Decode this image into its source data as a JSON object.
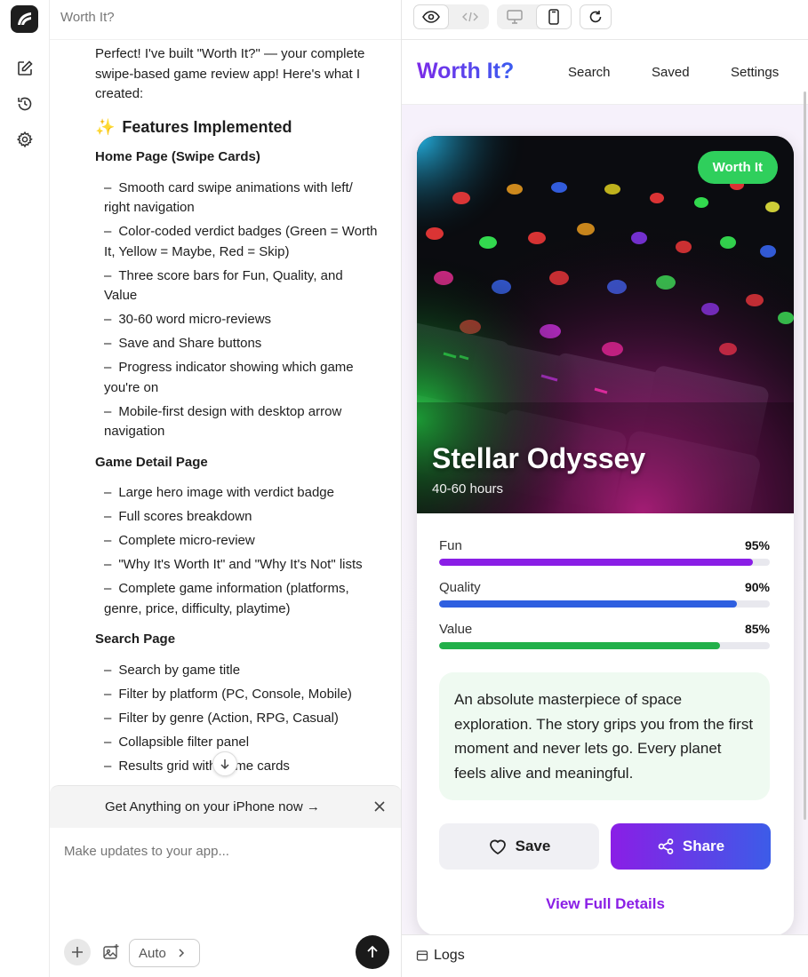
{
  "chat": {
    "title": "Worth It?",
    "intro": "Perfect! I've built \"Worth It?\" — your complete swipe-based game review app! Here's what I created:",
    "features_emoji": "✨",
    "features_heading": "Features Implemented",
    "sections": [
      {
        "heading": "Home Page (Swipe Cards)",
        "bullets": [
          "Smooth card swipe animations with left/ right navigation",
          "Color-coded verdict badges (Green = Worth It, Yellow = Maybe, Red = Skip)",
          "Three score bars for Fun, Quality, and Value",
          "30-60 word micro-reviews",
          "Save and Share buttons",
          "Progress indicator showing which game you're on",
          "Mobile-first design with desktop arrow navigation"
        ]
      },
      {
        "heading": "Game Detail Page",
        "bullets": [
          "Large hero image with verdict badge",
          "Full scores breakdown",
          "Complete micro-review",
          "\"Why It's Worth It\" and \"Why It's Not\" lists",
          "Complete game information (platforms, genre, price, difficulty, playtime)"
        ]
      },
      {
        "heading": "Search Page",
        "bullets": [
          "Search by game title",
          "Filter by platform (PC, Console, Mobile)",
          "Filter by genre (Action, RPG, Casual)",
          "Collapsible filter panel",
          "Results grid with game cards"
        ]
      }
    ],
    "bullet_dash": "–",
    "promo_text": "Get Anything on your iPhone now →",
    "composer_placeholder": "Make updates to your app...",
    "auto_label": "Auto"
  },
  "preview": {
    "logs_label": "Logs"
  },
  "app": {
    "brand": "Worth It?",
    "nav": [
      "Search",
      "Saved",
      "Settings"
    ],
    "game": {
      "title": "Stellar Odyssey",
      "playtime": "40-60 hours",
      "verdict": "Worth It",
      "verdict_color": "#2fcf5c",
      "scores": [
        {
          "label": "Fun",
          "value": "95%",
          "fraction": 0.95,
          "color": "#8a1ee6"
        },
        {
          "label": "Quality",
          "value": "90%",
          "fraction": 0.9,
          "color": "#2e5fe0"
        },
        {
          "label": "Value",
          "value": "85%",
          "fraction": 0.85,
          "color": "#22b04a"
        }
      ],
      "review": "An absolute masterpiece of space exploration. The story grips you from the first moment and never lets go. Every planet feels alive and meaningful."
    },
    "save_label": "Save",
    "share_label": "Share",
    "details_label": "View Full Details"
  },
  "colors": {
    "accent": "#8a1ee6",
    "accent2": "#3c5ce8"
  }
}
